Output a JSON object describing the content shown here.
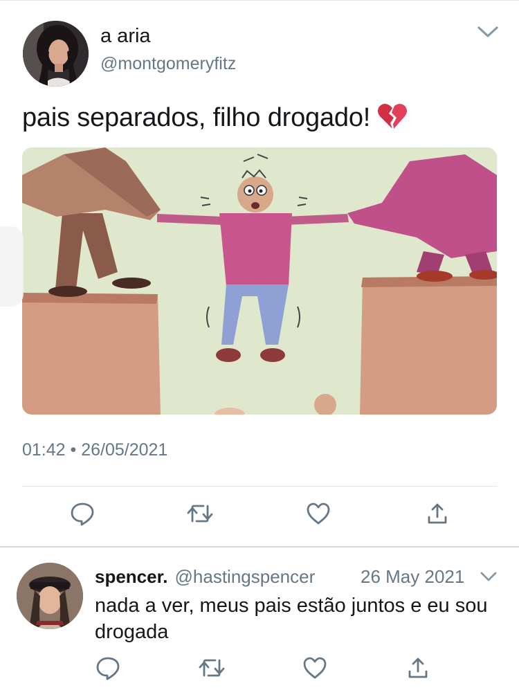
{
  "main_tweet": {
    "author_name": "a aria",
    "author_handle": "@montgomeryfitz",
    "text": "pais separados, filho drogado!",
    "emoji": "broken-heart-icon",
    "timestamp": "01:42 • 26/05/2021",
    "actions": [
      "reply-icon",
      "retweet-icon",
      "like-icon",
      "share-icon"
    ]
  },
  "reply_tweet": {
    "author_name": "spencer.",
    "author_handle": "@hastingspencer",
    "date": "26 May 2021",
    "text": "nada a ver, meus pais estão juntos e eu sou drogada",
    "actions": [
      "reply-icon",
      "retweet-icon",
      "like-icon",
      "share-icon"
    ]
  },
  "colors": {
    "text": "#14171a",
    "secondary": "#657786",
    "divider": "#e1e8ed",
    "icon": "#657786"
  }
}
